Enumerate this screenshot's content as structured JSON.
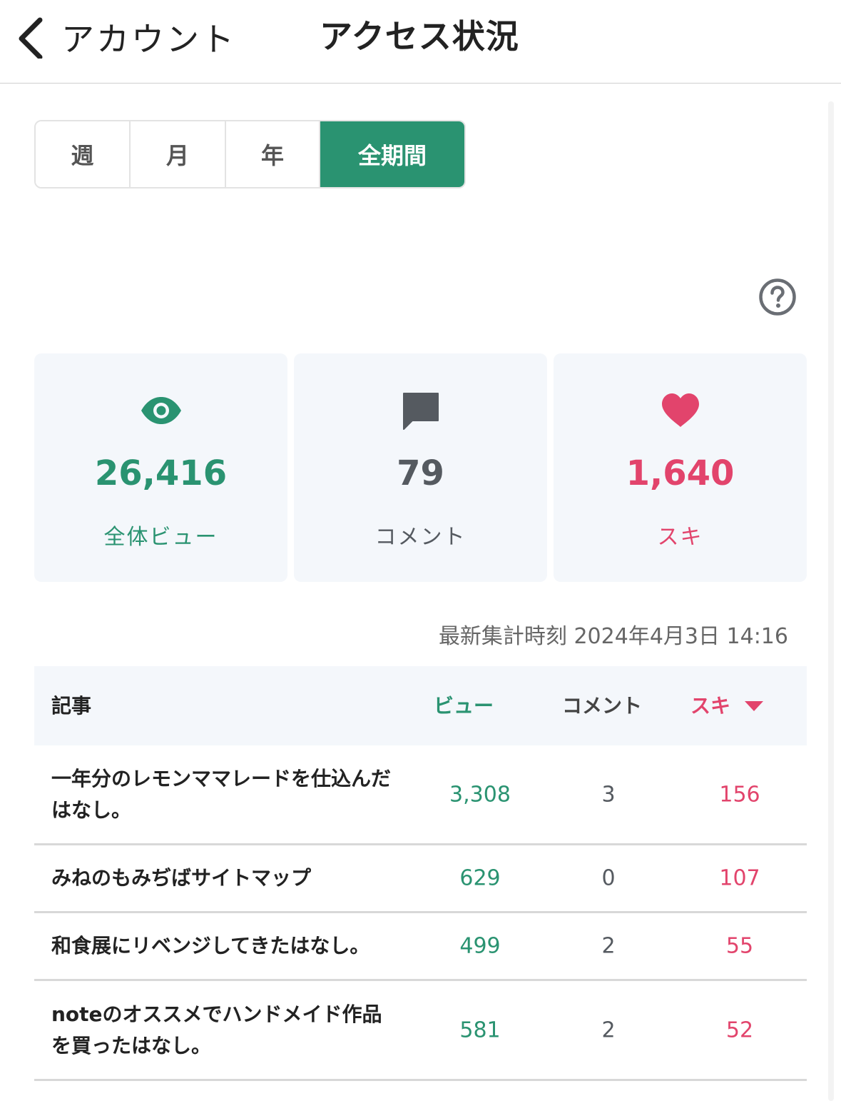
{
  "header": {
    "back_label": "アカウント",
    "title": "アクセス状況"
  },
  "period_tabs": [
    {
      "label": "週",
      "active": false
    },
    {
      "label": "月",
      "active": false
    },
    {
      "label": "年",
      "active": false
    },
    {
      "label": "全期間",
      "active": true
    }
  ],
  "stats": {
    "views": {
      "value": "26,416",
      "label": "全体ビュー"
    },
    "comments": {
      "value": "79",
      "label": "コメント"
    },
    "likes": {
      "value": "1,640",
      "label": "スキ"
    }
  },
  "updated_at": "最新集計時刻 2024年4月3日 14:16",
  "table": {
    "columns": {
      "article": "記事",
      "views": "ビュー",
      "comments": "コメント",
      "likes": "スキ"
    },
    "rows": [
      {
        "title": "一年分のレモンママレードを仕込んだはなし。",
        "views": "3,308",
        "comments": "3",
        "likes": "156"
      },
      {
        "title": "みねのもみぢばサイトマップ",
        "views": "629",
        "comments": "0",
        "likes": "107"
      },
      {
        "title": "和食展にリベンジしてきたはなし。",
        "views": "499",
        "comments": "2",
        "likes": "55"
      },
      {
        "title": "noteのオススメでハンドメイド作品を買ったはなし。",
        "views": "581",
        "comments": "2",
        "likes": "52"
      }
    ]
  },
  "colors": {
    "green": "#2a9371",
    "pink": "#e2446c",
    "gray": "#555a60"
  }
}
